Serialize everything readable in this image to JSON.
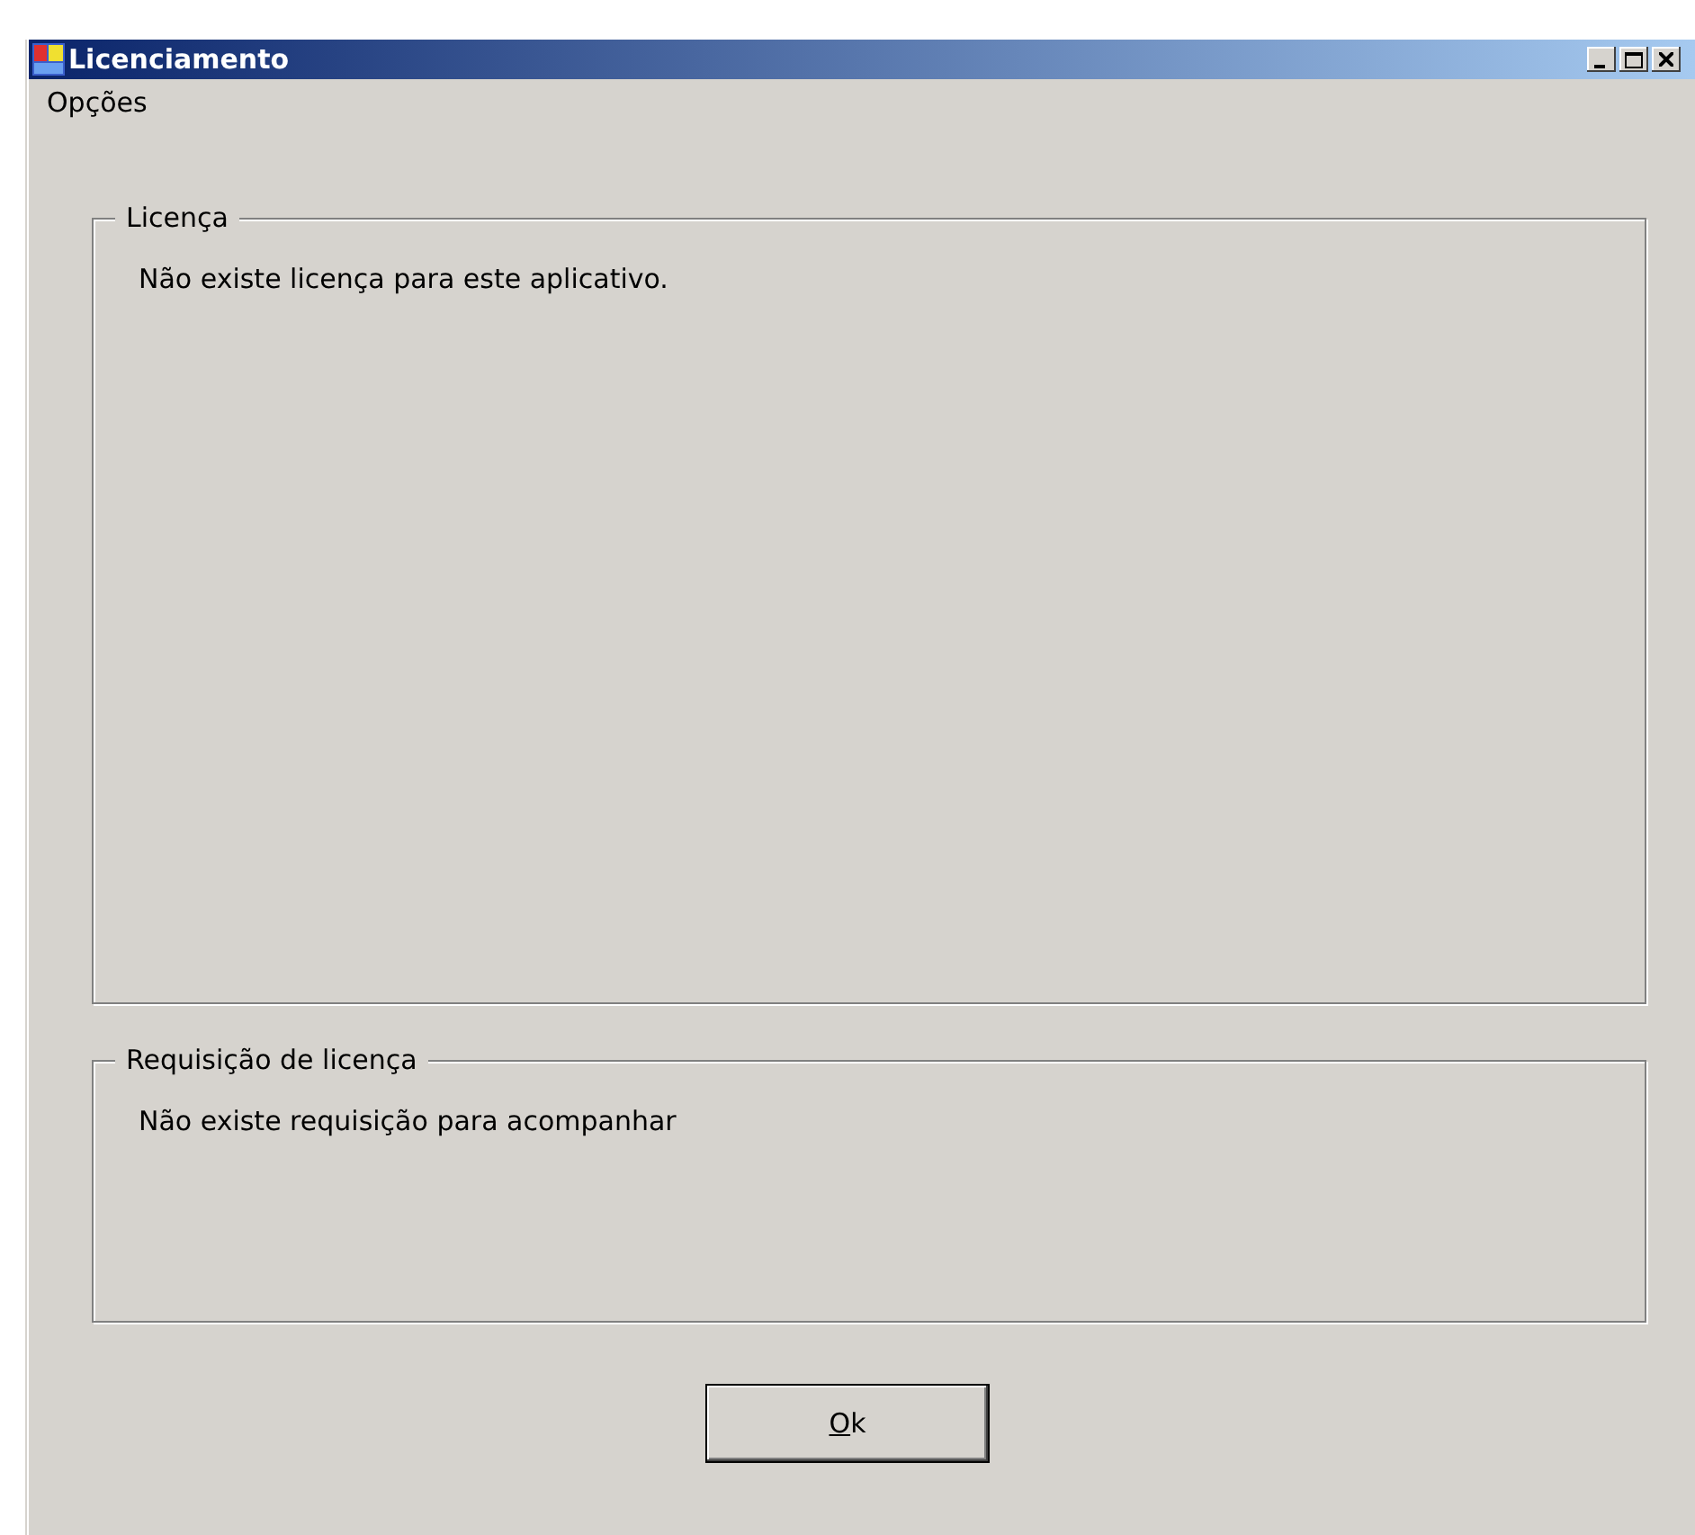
{
  "window": {
    "title": "Licenciamento"
  },
  "menu": [
    {
      "label": "Opções"
    }
  ],
  "groups": [
    {
      "title": "Licença",
      "message": "Não existe licença para este aplicativo."
    },
    {
      "title": "Requisição de licença",
      "message": "Não existe requisição para acompanhar"
    }
  ],
  "buttons": [
    {
      "label": "Ok"
    }
  ]
}
